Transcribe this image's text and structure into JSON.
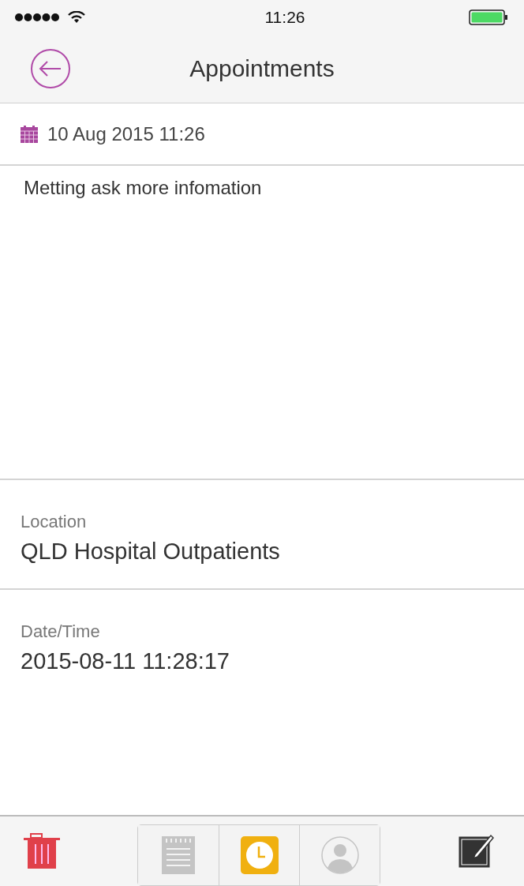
{
  "status_bar": {
    "time": "11:26"
  },
  "nav": {
    "title": "Appointments"
  },
  "created": "10 Aug 2015 11:26",
  "note": "Metting ask more infomation",
  "fields": [
    {
      "label": "Location",
      "value": "QLD Hospital Outpatients"
    },
    {
      "label": "Date/Time",
      "value": "2015-08-11 11:28:17"
    }
  ],
  "segments": [
    {
      "kind": "notes",
      "selected": false
    },
    {
      "kind": "reminder",
      "selected": true
    },
    {
      "kind": "contact",
      "selected": false
    }
  ]
}
